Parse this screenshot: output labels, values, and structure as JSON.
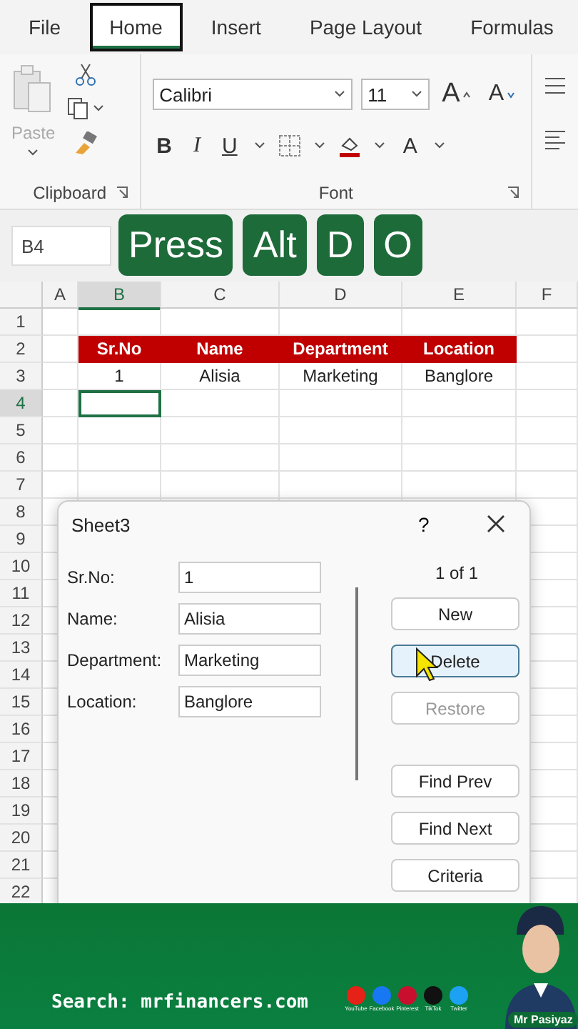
{
  "ribbon_tabs": [
    {
      "label": "File",
      "selected": false
    },
    {
      "label": "Home",
      "selected": true
    },
    {
      "label": "Insert",
      "selected": false
    },
    {
      "label": "Page Layout",
      "selected": false
    },
    {
      "label": "Formulas",
      "selected": false
    }
  ],
  "clipboard": {
    "paste_label": "Paste",
    "group_label": "Clipboard"
  },
  "font": {
    "family": "Calibri",
    "size": "11",
    "grow": "A",
    "shrink": "A",
    "bold": "B",
    "italic": "I",
    "underline": "U",
    "font_color": "A",
    "group_label": "Font"
  },
  "name_box": "B4",
  "keys": [
    "Press",
    "Alt",
    "D",
    "O"
  ],
  "sheet": {
    "columns": [
      {
        "label": "A",
        "selected": false
      },
      {
        "label": "B",
        "selected": true
      },
      {
        "label": "C",
        "selected": false
      },
      {
        "label": "D",
        "selected": false
      },
      {
        "label": "E",
        "selected": false
      },
      {
        "label": "F",
        "selected": false
      }
    ],
    "rows": [
      {
        "label": "1",
        "selected": false
      },
      {
        "label": "2",
        "selected": false
      },
      {
        "label": "3",
        "selected": false
      },
      {
        "label": "4",
        "selected": true
      },
      {
        "label": "5",
        "selected": false
      },
      {
        "label": "6",
        "selected": false
      },
      {
        "label": "7",
        "selected": false
      },
      {
        "label": "8",
        "selected": false
      },
      {
        "label": "9",
        "selected": false
      },
      {
        "label": "10",
        "selected": false
      },
      {
        "label": "11",
        "selected": false
      },
      {
        "label": "12",
        "selected": false
      },
      {
        "label": "13",
        "selected": false
      },
      {
        "label": "14",
        "selected": false
      },
      {
        "label": "15",
        "selected": false
      },
      {
        "label": "16",
        "selected": false
      },
      {
        "label": "17",
        "selected": false
      },
      {
        "label": "18",
        "selected": false
      },
      {
        "label": "19",
        "selected": false
      },
      {
        "label": "20",
        "selected": false
      },
      {
        "label": "21",
        "selected": false
      },
      {
        "label": "22",
        "selected": false
      }
    ],
    "headers": [
      "Sr.No",
      "Name",
      "Department",
      "Location"
    ],
    "data": [
      [
        "1",
        "Alisia",
        "Marketing",
        "Banglore"
      ]
    ]
  },
  "dialog": {
    "title": "Sheet3",
    "help": "?",
    "counter": "1 of 1",
    "fields": [
      {
        "label": "Sr.No:",
        "value": "1"
      },
      {
        "label": "Name:",
        "value": "Alisia"
      },
      {
        "label": "Department:",
        "value": "Marketing"
      },
      {
        "label": "Location:",
        "value": "Banglore"
      }
    ],
    "buttons": [
      {
        "label": "New",
        "disabled": false,
        "focused": false
      },
      {
        "label": "Delete",
        "disabled": false,
        "focused": true
      },
      {
        "label": "Restore",
        "disabled": true,
        "focused": false
      },
      {
        "label": "Find Prev",
        "disabled": false,
        "focused": false
      },
      {
        "label": "Find Next",
        "disabled": false,
        "focused": false
      },
      {
        "label": "Criteria",
        "disabled": false,
        "focused": false
      }
    ]
  },
  "footer": {
    "search": "Search: mrfinancers.com",
    "socials": [
      {
        "label": "YouTube",
        "color": "#e62117"
      },
      {
        "label": "Facebook",
        "color": "#1877f2"
      },
      {
        "label": "Pinterest",
        "color": "#c8102e"
      },
      {
        "label": "TikTok",
        "color": "#111111"
      },
      {
        "label": "Twitter",
        "color": "#1da1f2"
      }
    ],
    "name": "Mr Pasiyaz"
  }
}
